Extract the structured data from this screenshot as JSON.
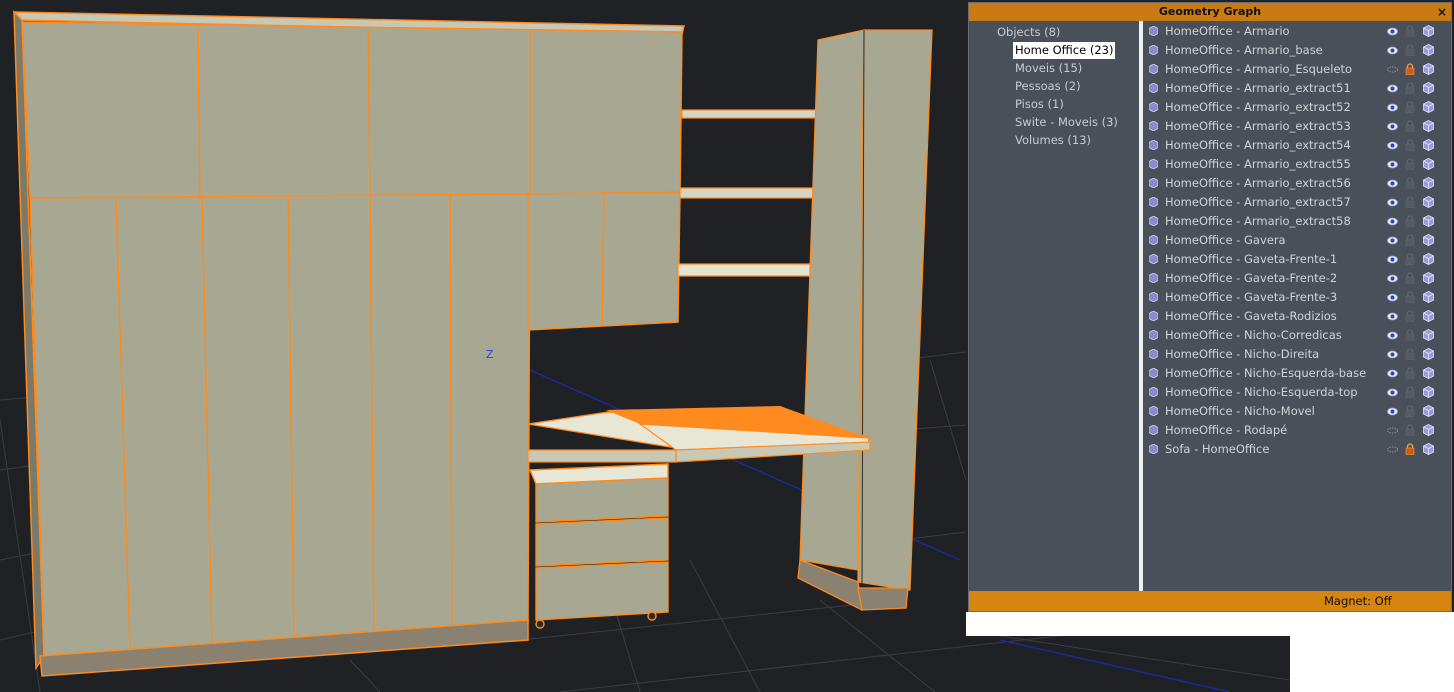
{
  "viewport": {
    "axis_label": "Z"
  },
  "panel": {
    "title": "Geometry Graph",
    "close_icon": "close-icon",
    "close_glyph": "×",
    "tree": {
      "items": [
        {
          "label": "Objects (8)",
          "selected": false,
          "level": 0
        },
        {
          "label": "Home Office (23)",
          "selected": true,
          "level": 1
        },
        {
          "label": "Moveis (15)",
          "selected": false,
          "level": 1
        },
        {
          "label": "Pessoas (2)",
          "selected": false,
          "level": 1
        },
        {
          "label": "Pisos (1)",
          "selected": false,
          "level": 1
        },
        {
          "label": "Swite - Moveis (3)",
          "selected": false,
          "level": 1
        },
        {
          "label": "Volumes (13)",
          "selected": false,
          "level": 1
        }
      ]
    },
    "objects": [
      {
        "name": "HomeOffice - Armario",
        "visible": true,
        "locked": false
      },
      {
        "name": "HomeOffice - Armario_base",
        "visible": true,
        "locked": false
      },
      {
        "name": "HomeOffice - Armario_Esqueleto",
        "visible": false,
        "locked": true
      },
      {
        "name": "HomeOffice - Armario_extract51",
        "visible": true,
        "locked": false
      },
      {
        "name": "HomeOffice - Armario_extract52",
        "visible": true,
        "locked": false
      },
      {
        "name": "HomeOffice - Armario_extract53",
        "visible": true,
        "locked": false
      },
      {
        "name": "HomeOffice - Armario_extract54",
        "visible": true,
        "locked": false
      },
      {
        "name": "HomeOffice - Armario_extract55",
        "visible": true,
        "locked": false
      },
      {
        "name": "HomeOffice - Armario_extract56",
        "visible": true,
        "locked": false
      },
      {
        "name": "HomeOffice - Armario_extract57",
        "visible": true,
        "locked": false
      },
      {
        "name": "HomeOffice - Armario_extract58",
        "visible": true,
        "locked": false
      },
      {
        "name": "HomeOffice - Gavera",
        "visible": true,
        "locked": false
      },
      {
        "name": "HomeOffice - Gaveta-Frente-1",
        "visible": true,
        "locked": false
      },
      {
        "name": "HomeOffice - Gaveta-Frente-2",
        "visible": true,
        "locked": false
      },
      {
        "name": "HomeOffice - Gaveta-Frente-3",
        "visible": true,
        "locked": false
      },
      {
        "name": "HomeOffice - Gaveta-Rodizios",
        "visible": true,
        "locked": false
      },
      {
        "name": "HomeOffice - Nicho-Corredicas",
        "visible": true,
        "locked": false
      },
      {
        "name": "HomeOffice - Nicho-Direita",
        "visible": true,
        "locked": false
      },
      {
        "name": "HomeOffice - Nicho-Esquerda-base",
        "visible": true,
        "locked": false
      },
      {
        "name": "HomeOffice - Nicho-Esquerda-top",
        "visible": true,
        "locked": false
      },
      {
        "name": "HomeOffice - Nicho-Movel",
        "visible": true,
        "locked": false
      },
      {
        "name": "HomeOffice - Rodapé",
        "visible": false,
        "locked": false
      },
      {
        "name": "Sofa - HomeOffice",
        "visible": false,
        "locked": true
      }
    ],
    "status": {
      "magnet": "Magnet: Off"
    }
  },
  "colors": {
    "panel_bg": "#4a5059",
    "title_bar": "#c97a12",
    "status_bar": "#d58510",
    "viewport_bg": "#1f2125",
    "selection_outline": "#ff8a1e",
    "cabinet_face": "#a8a892"
  }
}
